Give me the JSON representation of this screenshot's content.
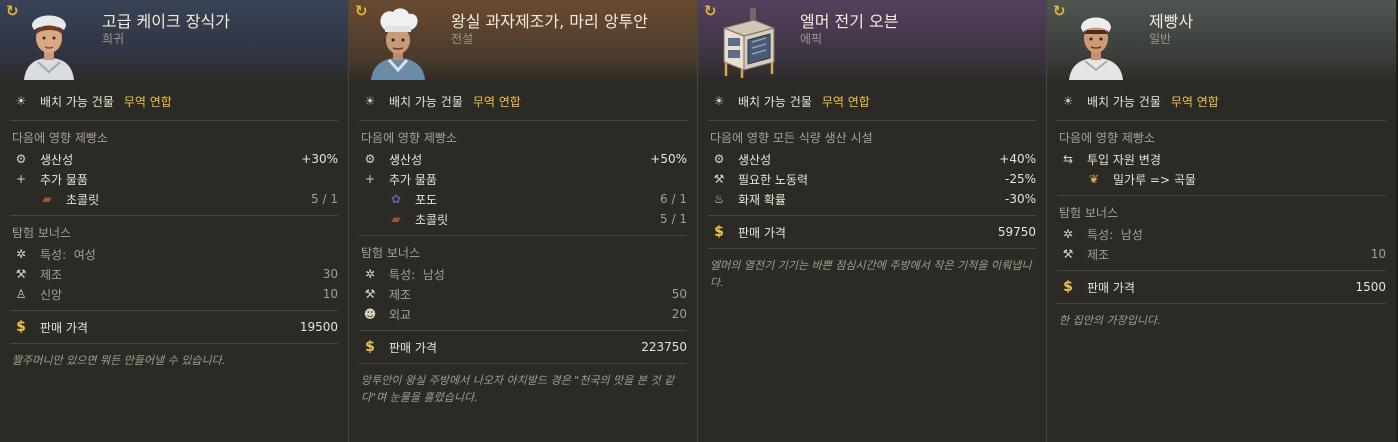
{
  "common": {
    "building_label": "배치 가능 건물",
    "building_value": "무역 연합",
    "affects_prefix": "다음에 영향",
    "expedition_label": "탐험 보너스",
    "price_label": "판매 가격",
    "trait_label": "특성:"
  },
  "cards": [
    {
      "name": "고급 케이크 장식가",
      "rarity": "희귀",
      "affects": "제빵소",
      "effects": [
        {
          "icon": "productivity-icon",
          "label": "생산성",
          "value": "+30%"
        },
        {
          "icon": "plus-icon",
          "label": "추가 물품",
          "value": ""
        }
      ],
      "extra_goods": [
        {
          "icon": "chocolate-icon",
          "label": "초콜릿",
          "value": "5 / 1"
        }
      ],
      "trait": "여성",
      "bonuses": [
        {
          "icon": "crafting-icon",
          "label": "제조",
          "value": "30"
        },
        {
          "icon": "faith-icon",
          "label": "신앙",
          "value": "10"
        }
      ],
      "price": "19500",
      "flavor": "짤주머니만 있으면 뭐든 만들어낼 수 있습니다."
    },
    {
      "name": "왕실 과자제조가, 마리 앙투안",
      "rarity": "전설",
      "affects": "제빵소",
      "effects": [
        {
          "icon": "productivity-icon",
          "label": "생산성",
          "value": "+50%"
        },
        {
          "icon": "plus-icon",
          "label": "추가 물품",
          "value": ""
        }
      ],
      "extra_goods": [
        {
          "icon": "grapes-icon",
          "label": "포도",
          "value": "6 / 1"
        },
        {
          "icon": "chocolate-icon",
          "label": "초콜릿",
          "value": "5 / 1"
        }
      ],
      "trait": "남성",
      "bonuses": [
        {
          "icon": "crafting-icon",
          "label": "제조",
          "value": "50"
        },
        {
          "icon": "diplomacy-icon",
          "label": "외교",
          "value": "20"
        }
      ],
      "price": "223750",
      "flavor": "앙투안이 왕실 주방에서 나오자 아치발드 경은 \"천국의 맛을 본 것 같다\"며 눈물을 흘렸습니다."
    },
    {
      "name": "엘머 전기 오븐",
      "rarity": "에픽",
      "affects": "모든 식량 생산 시설",
      "effects": [
        {
          "icon": "productivity-icon",
          "label": "생산성",
          "value": "+40%"
        },
        {
          "icon": "workforce-icon",
          "label": "필요한 노동력",
          "value": "-25%"
        },
        {
          "icon": "fire-icon",
          "label": "화재 확률",
          "value": "-30%"
        }
      ],
      "price": "59750",
      "flavor": "엘머의 열전기 기기는 바쁜 점심시간에 주방에서 작은 기적을 이뤄냅니다."
    },
    {
      "name": "제빵사",
      "rarity": "일반",
      "affects": "제빵소",
      "effects": [
        {
          "icon": "swap-icon",
          "label": "투입 자원 변경",
          "value": ""
        }
      ],
      "input_change": {
        "icon": "wheat-icon",
        "label": "밀가루 => 곡물"
      },
      "trait": "남성",
      "bonuses": [
        {
          "icon": "crafting-icon",
          "label": "제조",
          "value": "10"
        }
      ],
      "price": "1500",
      "flavor": "한 집안의 가장입니다."
    }
  ]
}
